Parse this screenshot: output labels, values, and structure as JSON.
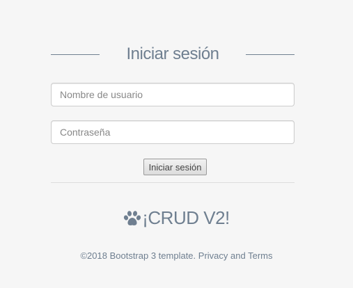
{
  "login": {
    "title": "Iniciar sesión",
    "username_placeholder": "Nombre de usuario",
    "username_value": "",
    "password_placeholder": "Contraseña",
    "password_value": "",
    "submit_label": "Iniciar sesión"
  },
  "brand": {
    "icon": "paw-icon",
    "name": "¡CRUD V2!"
  },
  "footer": {
    "copyright": "©2018 Bootstrap 3 template.",
    "privacy_link": "Privacy",
    "and": "and",
    "terms_link": "Terms"
  },
  "colors": {
    "accent": "#6f7f90",
    "background": "#f6f6f6"
  }
}
